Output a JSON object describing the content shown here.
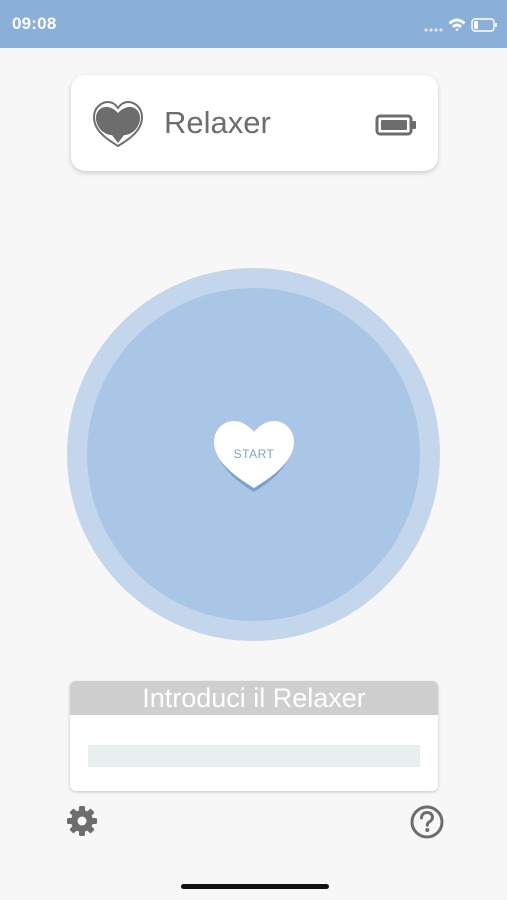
{
  "status_bar": {
    "time": "09:08",
    "icons": [
      "signal-icon",
      "wifi-icon",
      "battery-icon"
    ],
    "color": "#8aafd9"
  },
  "header": {
    "title": "Relaxer",
    "logo_icon": "heart-logo-icon",
    "device_battery_icon": "battery-icon"
  },
  "main": {
    "start_label": "START"
  },
  "intro_panel": {
    "title": "Introduci il Relaxer",
    "progress": 0
  },
  "footer": {
    "settings_icon": "gear-icon",
    "help_icon": "help-circle-icon"
  },
  "colors": {
    "accent": "#8aafd9",
    "circle_outer": "#c4d6ec",
    "circle_inner": "#aac6e6",
    "icon_gray": "#6d6d6d"
  }
}
